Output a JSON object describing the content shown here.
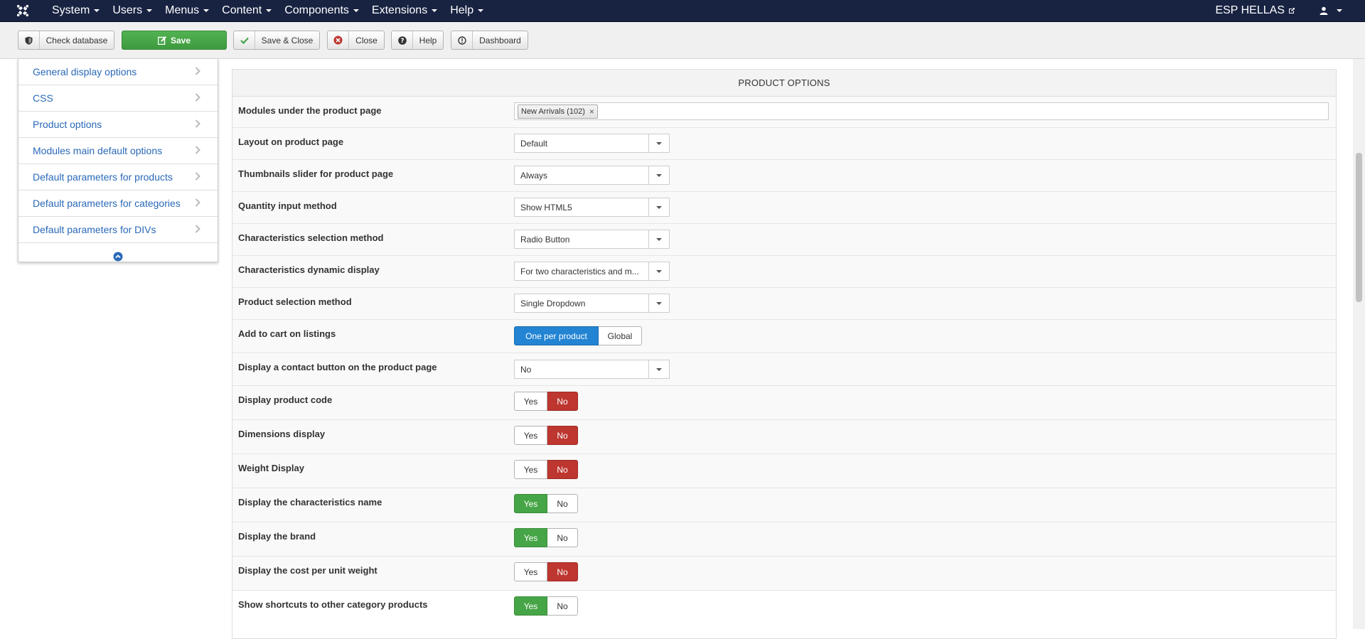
{
  "navbar": {
    "menu": [
      {
        "label": "System",
        "name": "nav-menu-system"
      },
      {
        "label": "Users",
        "name": "nav-menu-users"
      },
      {
        "label": "Menus",
        "name": "nav-menu-menus"
      },
      {
        "label": "Content",
        "name": "nav-menu-content"
      },
      {
        "label": "Components",
        "name": "nav-menu-components"
      },
      {
        "label": "Extensions",
        "name": "nav-menu-extensions"
      },
      {
        "label": "Help",
        "name": "nav-menu-help"
      }
    ],
    "site_name": "ESP HELLAS"
  },
  "toolbar": {
    "check_database": "Check database",
    "save": "Save",
    "save_close": "Save & Close",
    "close": "Close",
    "help": "Help",
    "dashboard": "Dashboard"
  },
  "sidebar": {
    "items": [
      "General display options",
      "CSS",
      "Product options",
      "Modules main default options",
      "Default parameters for products",
      "Default parameters for categories",
      "Default parameters for DIVs"
    ]
  },
  "panel": {
    "title": "PRODUCT OPTIONS",
    "rows": {
      "modules_under": {
        "label": "Modules under the product page",
        "tag": "New Arrivals (102)"
      },
      "layout": {
        "label": "Layout on product page",
        "value": "Default"
      },
      "thumbnails": {
        "label": "Thumbnails slider for product page",
        "value": "Always"
      },
      "quantity": {
        "label": "Quantity input method",
        "value": "Show HTML5"
      },
      "char_selection": {
        "label": "Characteristics selection method",
        "value": "Radio Button"
      },
      "char_dynamic": {
        "label": "Characteristics dynamic display",
        "value": "For two characteristics and m..."
      },
      "product_selection": {
        "label": "Product selection method",
        "value": "Single Dropdown"
      },
      "add_to_cart": {
        "label": "Add to cart on listings",
        "option_a": "One per product",
        "option_b": "Global"
      },
      "contact_button": {
        "label": "Display a contact button on the product page",
        "value": "No"
      },
      "product_code": {
        "label": "Display product code",
        "yes": "Yes",
        "no": "No"
      },
      "dimensions": {
        "label": "Dimensions display",
        "yes": "Yes",
        "no": "No"
      },
      "weight": {
        "label": "Weight Display",
        "yes": "Yes",
        "no": "No"
      },
      "char_name": {
        "label": "Display the characteristics name",
        "yes": "Yes",
        "no": "No"
      },
      "brand": {
        "label": "Display the brand",
        "yes": "Yes",
        "no": "No"
      },
      "cost_per_unit": {
        "label": "Display the cost per unit weight",
        "yes": "Yes",
        "no": "No"
      },
      "shortcuts": {
        "label": "Show shortcuts to other category products",
        "yes": "Yes",
        "no": "No"
      }
    }
  },
  "colors": {
    "navbar_bg": "#182342",
    "save_green": "#46a546",
    "yes_green": "#46a546",
    "no_red": "#bd362f",
    "selected_blue": "#2384d3",
    "link_blue": "#2a69b8"
  }
}
